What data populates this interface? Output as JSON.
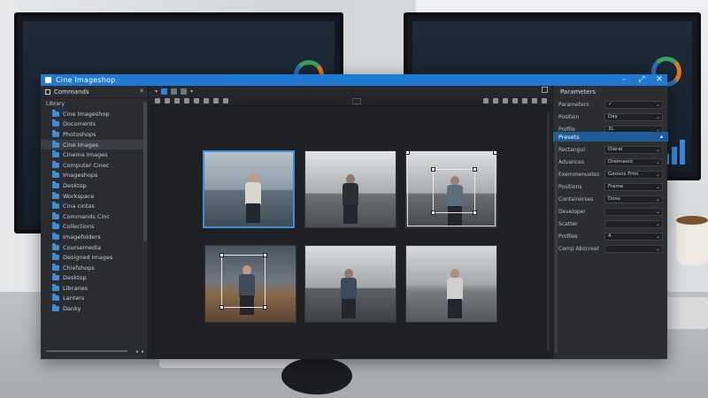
{
  "window": {
    "title": "Cine Imageshop"
  },
  "window_controls": [
    "–",
    "⤢",
    "✕"
  ],
  "folders_panel": {
    "title": "Commands",
    "root": "Library",
    "items": [
      {
        "label": "Cine Imageshop",
        "selected": false
      },
      {
        "label": "Documents",
        "selected": false
      },
      {
        "label": "Photoshops",
        "selected": false
      },
      {
        "label": "Cine Images",
        "selected": true
      },
      {
        "label": "Cinema Images",
        "selected": false
      },
      {
        "label": "Computer Cinec",
        "selected": false
      },
      {
        "label": "Imageshops",
        "selected": false
      },
      {
        "label": "Desktop",
        "selected": false
      },
      {
        "label": "Workspace",
        "selected": false
      },
      {
        "label": "Cina cintas",
        "selected": false
      },
      {
        "label": "Commands Cinc",
        "selected": false
      },
      {
        "label": "Collections",
        "selected": false
      },
      {
        "label": "Imagefolders",
        "selected": false
      },
      {
        "label": "Coursemedia",
        "selected": false
      },
      {
        "label": "Designed Images",
        "selected": false
      },
      {
        "label": "Chiefshops",
        "selected": false
      },
      {
        "label": "Desktop",
        "selected": false
      },
      {
        "label": "Libraries",
        "selected": false
      },
      {
        "label": "Lanters",
        "selected": false
      },
      {
        "label": "Danky",
        "selected": false
      }
    ]
  },
  "properties_panel": {
    "title": "Parameters",
    "rows_top": [
      {
        "label": "Parameters",
        "value": "✓"
      },
      {
        "label": "Position",
        "value": "Day"
      },
      {
        "label": "Profile",
        "value": "3L"
      }
    ],
    "section": "Presets",
    "rows_main": [
      {
        "label": "Rectangul",
        "value": "Dieral"
      },
      {
        "label": "Advances",
        "value": "Dreimesid"
      },
      {
        "label": "Exemmenuetes",
        "value": "Geovos Frim"
      },
      {
        "label": "Positions",
        "value": "Frame"
      },
      {
        "label": "Containerses",
        "value": "Dose"
      },
      {
        "label": "Developer",
        "value": ""
      },
      {
        "label": "Scatter",
        "value": ""
      },
      {
        "label": "Profiles",
        "value": "4"
      },
      {
        "label": "Cemp Abscreation",
        "value": ""
      }
    ]
  },
  "colors": {
    "accent": "#1f7ad1",
    "panel": "#2a2c30",
    "canvas": "#1f2023",
    "folder": "#3b8fd9"
  },
  "icons": {
    "app": "app-icon",
    "folder": "folder-icon",
    "minimize": "minimize-icon",
    "maximize": "maximize-icon",
    "close": "close-icon"
  }
}
